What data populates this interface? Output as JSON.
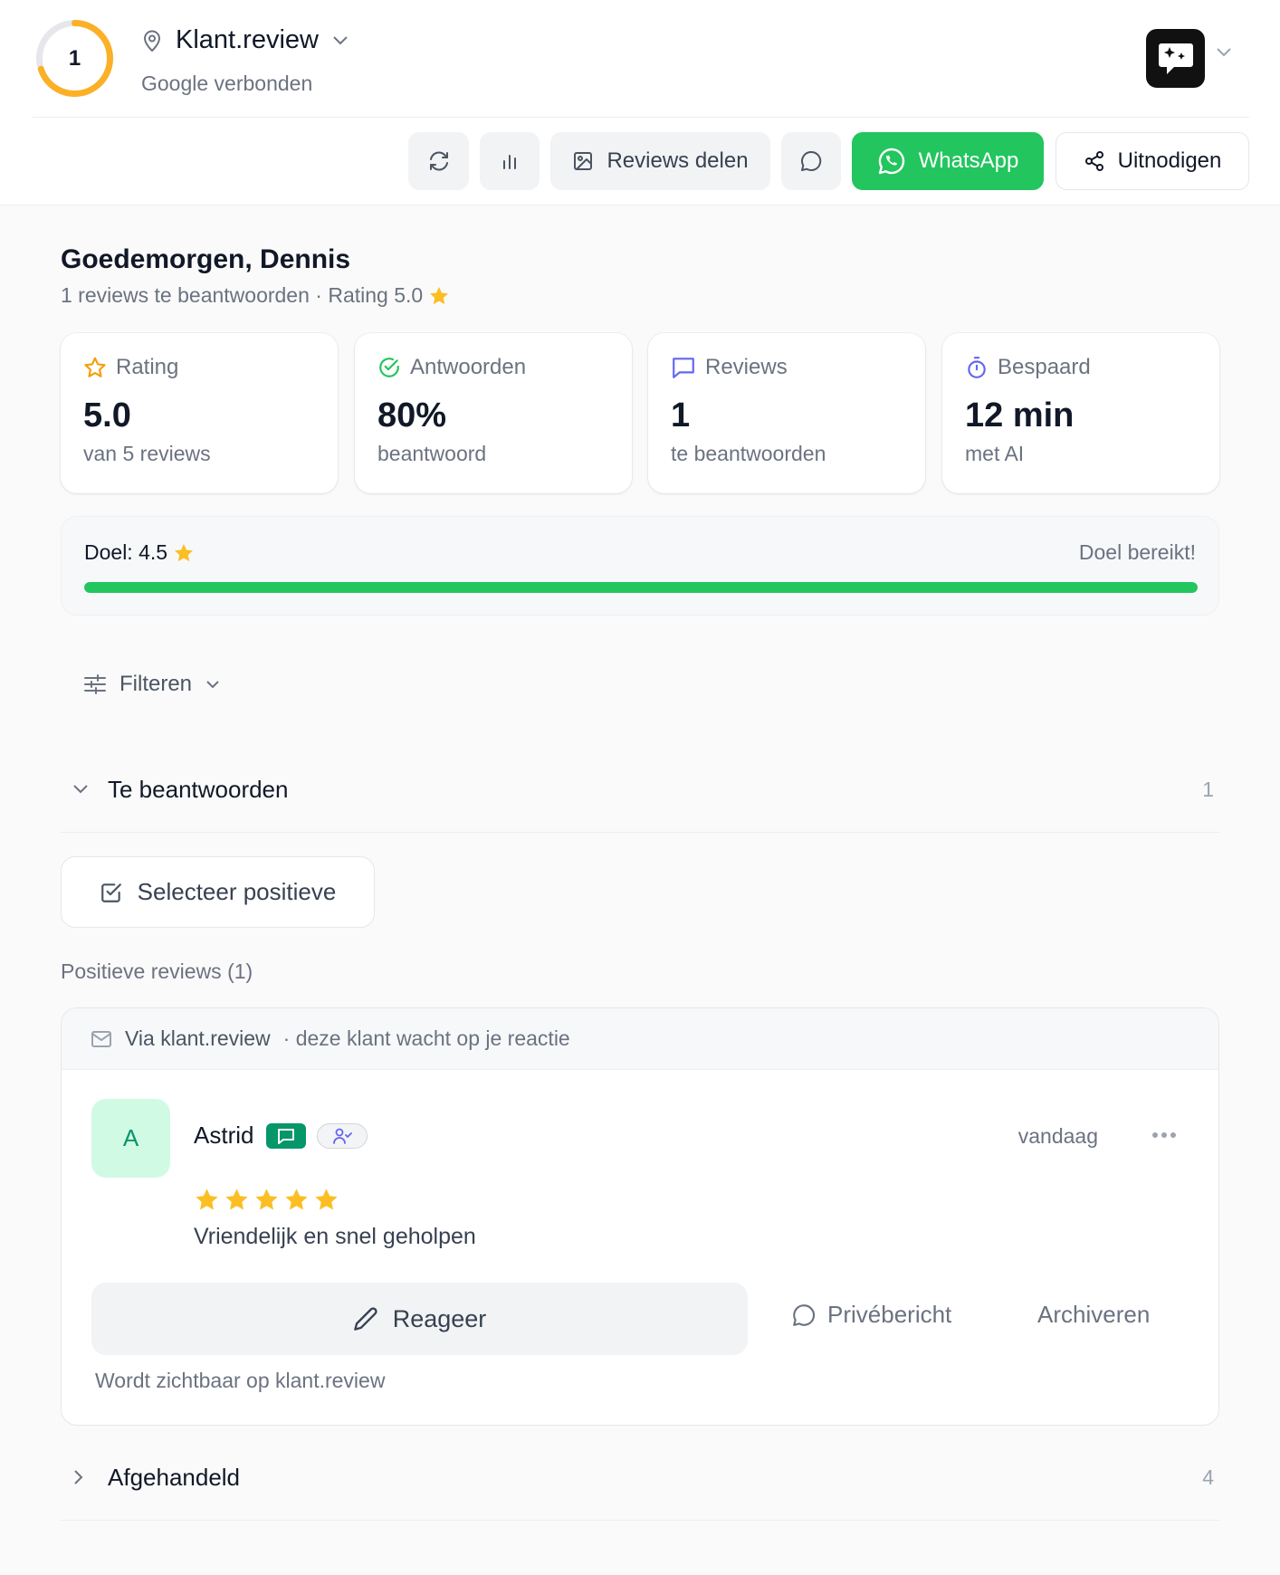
{
  "header": {
    "notification_count": "1",
    "ring_progress": 0.7,
    "location_name": "Klant.review",
    "connection_status": "Google verbonden"
  },
  "toolbar": {
    "share_reviews_label": "Reviews delen",
    "whatsapp_label": "WhatsApp",
    "invite_label": "Uitnodigen"
  },
  "greeting": {
    "title": "Goedemorgen, Dennis",
    "subtitle": "1 reviews te beantwoorden · Rating 5.0"
  },
  "stats": [
    {
      "label": "Rating",
      "value": "5.0",
      "sub": "van 5 reviews",
      "icon": "star-outline-icon",
      "color": "#f59e0b"
    },
    {
      "label": "Antwoorden",
      "value": "80%",
      "sub": "beantwoord",
      "icon": "check-circle-icon",
      "color": "#22c55e"
    },
    {
      "label": "Reviews",
      "value": "1",
      "sub": "te beantwoorden",
      "icon": "message-square-icon",
      "color": "#6366f1"
    },
    {
      "label": "Bespaard",
      "value": "12 min",
      "sub": "met AI",
      "icon": "timer-icon",
      "color": "#6366f1"
    }
  ],
  "goal": {
    "label": "Doel: 4.5",
    "status": "Doel bereikt!",
    "progress": 1.0,
    "color": "#22c55e"
  },
  "filter": {
    "label": "Filteren"
  },
  "sections": {
    "pending": {
      "title": "Te beantwoorden",
      "count": "1"
    },
    "done": {
      "title": "Afgehandeld",
      "count": "4"
    }
  },
  "select_positive_label": "Selecteer positieve",
  "positive_label": "Positieve reviews (1)",
  "review": {
    "source": "Via klant.review",
    "source_note": "· deze klant wacht op je reactie",
    "avatar_letter": "A",
    "author": "Astrid",
    "date": "vandaag",
    "rating": 5,
    "text": "Vriendelijk en snel geholpen",
    "reply_label": "Reageer",
    "private_label": "Privébericht",
    "archive_label": "Archiveren",
    "visibility_note": "Wordt zichtbaar op klant.review"
  },
  "colors": {
    "accent_green": "#22c55e",
    "ring_orange": "#fbb026",
    "star": "#fbbf24"
  }
}
